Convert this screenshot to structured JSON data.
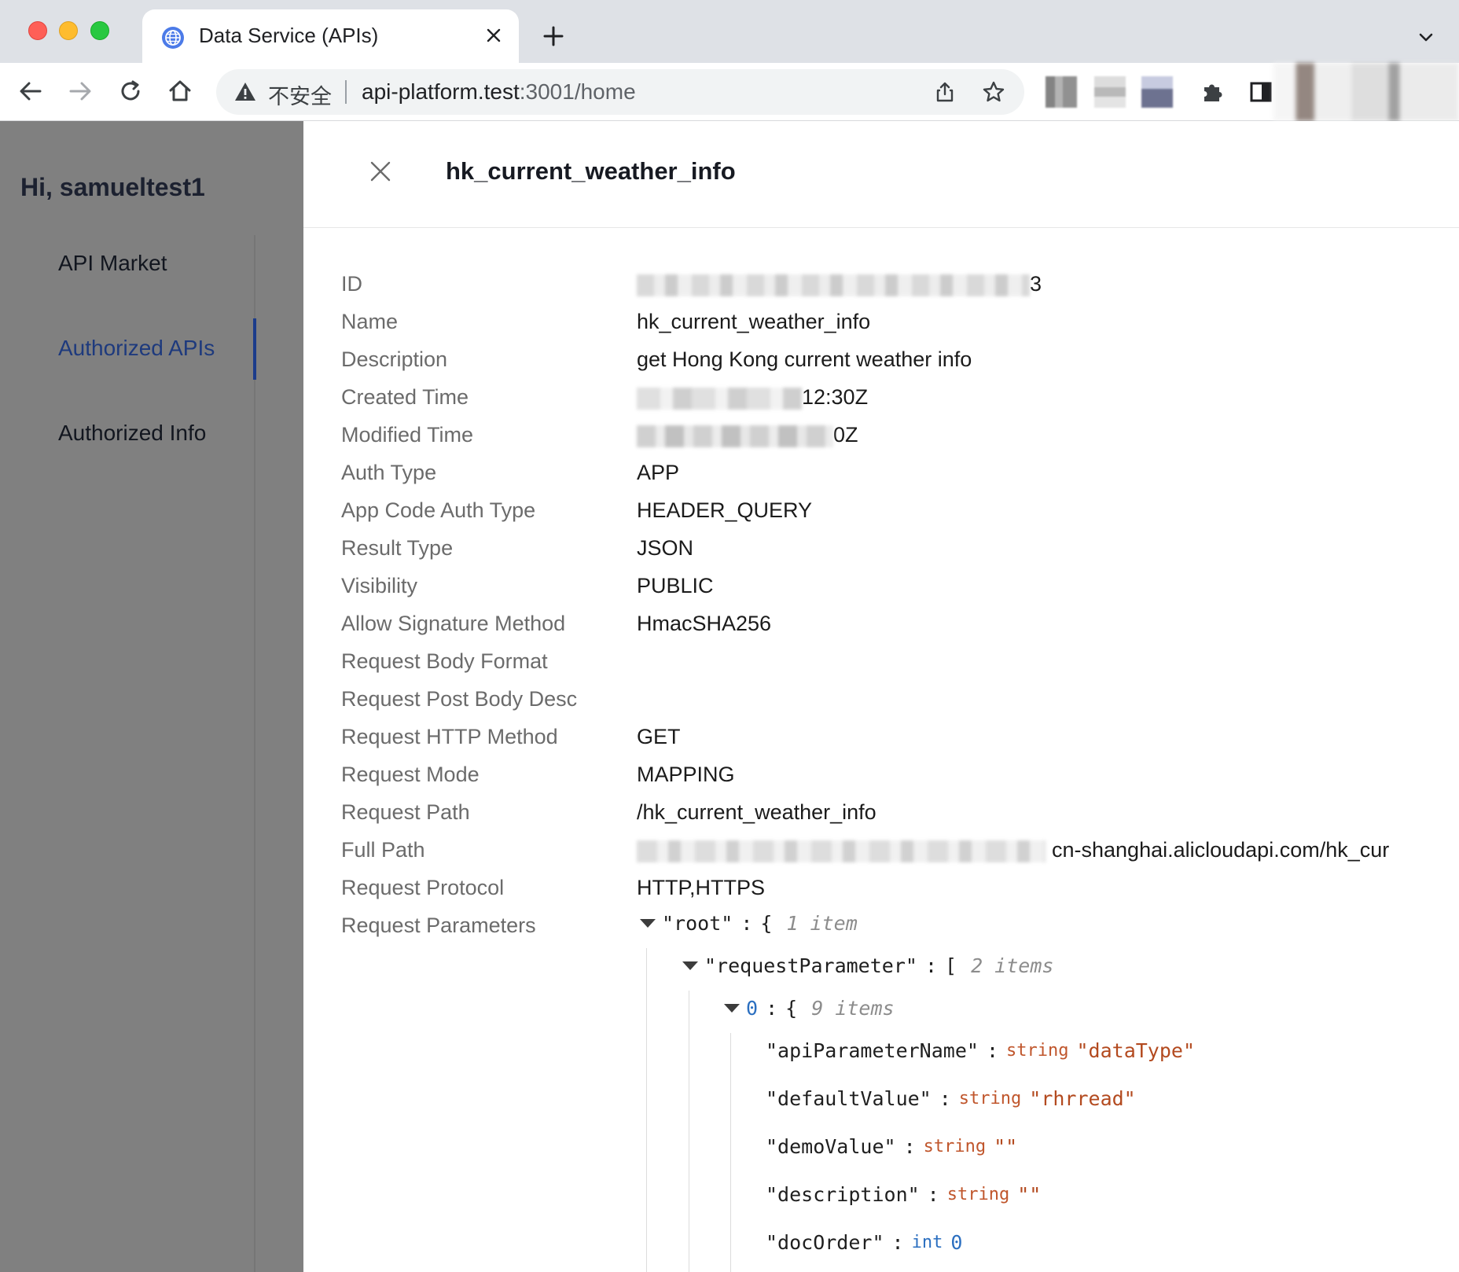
{
  "browser": {
    "tab_title": "Data Service (APIs)",
    "omnibox": {
      "insecure_label": "不安全",
      "url_host": "api-platform.test",
      "url_rest": ":3001/home"
    },
    "icons": [
      "globe-icon",
      "close-icon",
      "plus-icon",
      "chevron-down-icon",
      "back-arrow-icon",
      "forward-arrow-icon",
      "reload-icon",
      "home-icon",
      "warning-icon",
      "share-icon",
      "star-icon",
      "puzzle-icon",
      "side-panel-icon"
    ]
  },
  "sidebar": {
    "greeting": "Hi, samueltest1",
    "items": [
      {
        "label": "API Market",
        "active": false
      },
      {
        "label": "Authorized APIs",
        "active": true
      },
      {
        "label": "Authorized Info",
        "active": false
      }
    ]
  },
  "drawer": {
    "title": "hk_current_weather_info",
    "fields": [
      {
        "label": "ID",
        "value": "3"
      },
      {
        "label": "Name",
        "value": "hk_current_weather_info"
      },
      {
        "label": "Description",
        "value": "get Hong Kong current weather info"
      },
      {
        "label": "Created Time",
        "value": "12:30Z"
      },
      {
        "label": "Modified Time",
        "value": "0Z"
      },
      {
        "label": "Auth Type",
        "value": "APP"
      },
      {
        "label": "App Code Auth Type",
        "value": "HEADER_QUERY"
      },
      {
        "label": "Result Type",
        "value": "JSON"
      },
      {
        "label": "Visibility",
        "value": "PUBLIC"
      },
      {
        "label": "Allow Signature Method",
        "value": "HmacSHA256"
      },
      {
        "label": "Request Body Format",
        "value": ""
      },
      {
        "label": "Request Post Body Desc",
        "value": ""
      },
      {
        "label": "Request HTTP Method",
        "value": "GET"
      },
      {
        "label": "Request Mode",
        "value": "MAPPING"
      },
      {
        "label": "Request Path",
        "value": "/hk_current_weather_info"
      },
      {
        "label": "Full Path",
        "value": "cn-shanghai.alicloudapi.com/hk_cur"
      },
      {
        "label": "Request Protocol",
        "value": "HTTP,HTTPS"
      },
      {
        "label": "Request Parameters",
        "value": ""
      }
    ],
    "json_tree": {
      "root_key": "\"root\"",
      "root_brace": "{",
      "root_count": "1 item",
      "req_key": "\"requestParameter\"",
      "req_bracket": "[",
      "req_count": "2 items",
      "item_index": "0",
      "item_brace": "{",
      "item_count": "9 items",
      "colon": ":",
      "entries": [
        {
          "key": "\"apiParameterName\"",
          "type": "string",
          "value": "\"dataType\""
        },
        {
          "key": "\"defaultValue\"",
          "type": "string",
          "value": "\"rhrread\""
        },
        {
          "key": "\"demoValue\"",
          "type": "string",
          "value": "\"\""
        },
        {
          "key": "\"description\"",
          "type": "string",
          "value": "\"\""
        },
        {
          "key": "\"docOrder\"",
          "type": "int",
          "value": "0"
        }
      ]
    }
  }
}
